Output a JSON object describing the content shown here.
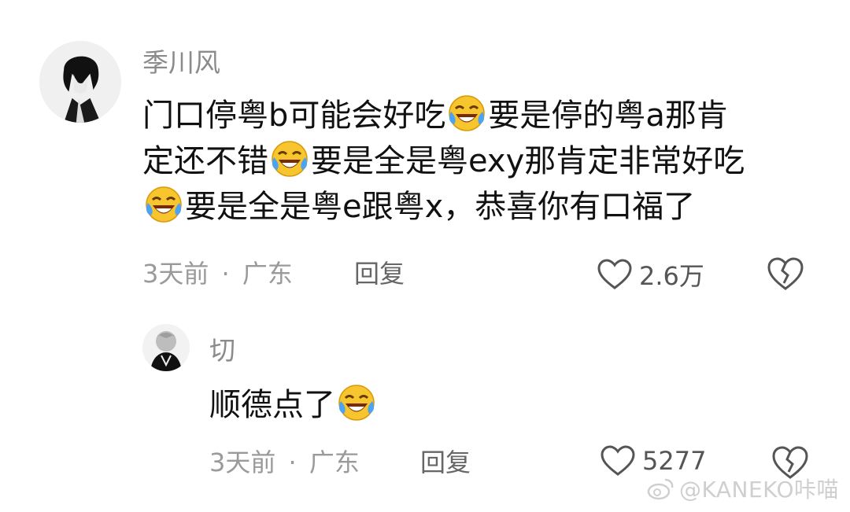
{
  "comment": {
    "username": "季川风",
    "text_segments": [
      "门口停粤b可能会好吃",
      "要是停的粤a那肯",
      "定还不错",
      "要是全是粤exy那肯定非常好吃",
      "要是全是粤e跟粤x，恭喜你有口福了"
    ],
    "emoji": "crying-laughing-emoji",
    "time": "3天前",
    "dot": "·",
    "location": "广东",
    "reply_label": "回复",
    "likes": "2.6万"
  },
  "reply": {
    "username": "切",
    "text": "顺德点了",
    "emoji": "crying-laughing-emoji",
    "time": "3天前",
    "dot": "·",
    "location": "广东",
    "reply_label": "回复",
    "likes": "5277"
  },
  "watermark": {
    "text": "@KANEKO咔喵"
  },
  "colors": {
    "text": "#111111",
    "meta": "#9a9a9a",
    "emoji_face": "#f7c52d",
    "tear": "#4ea3f1"
  }
}
